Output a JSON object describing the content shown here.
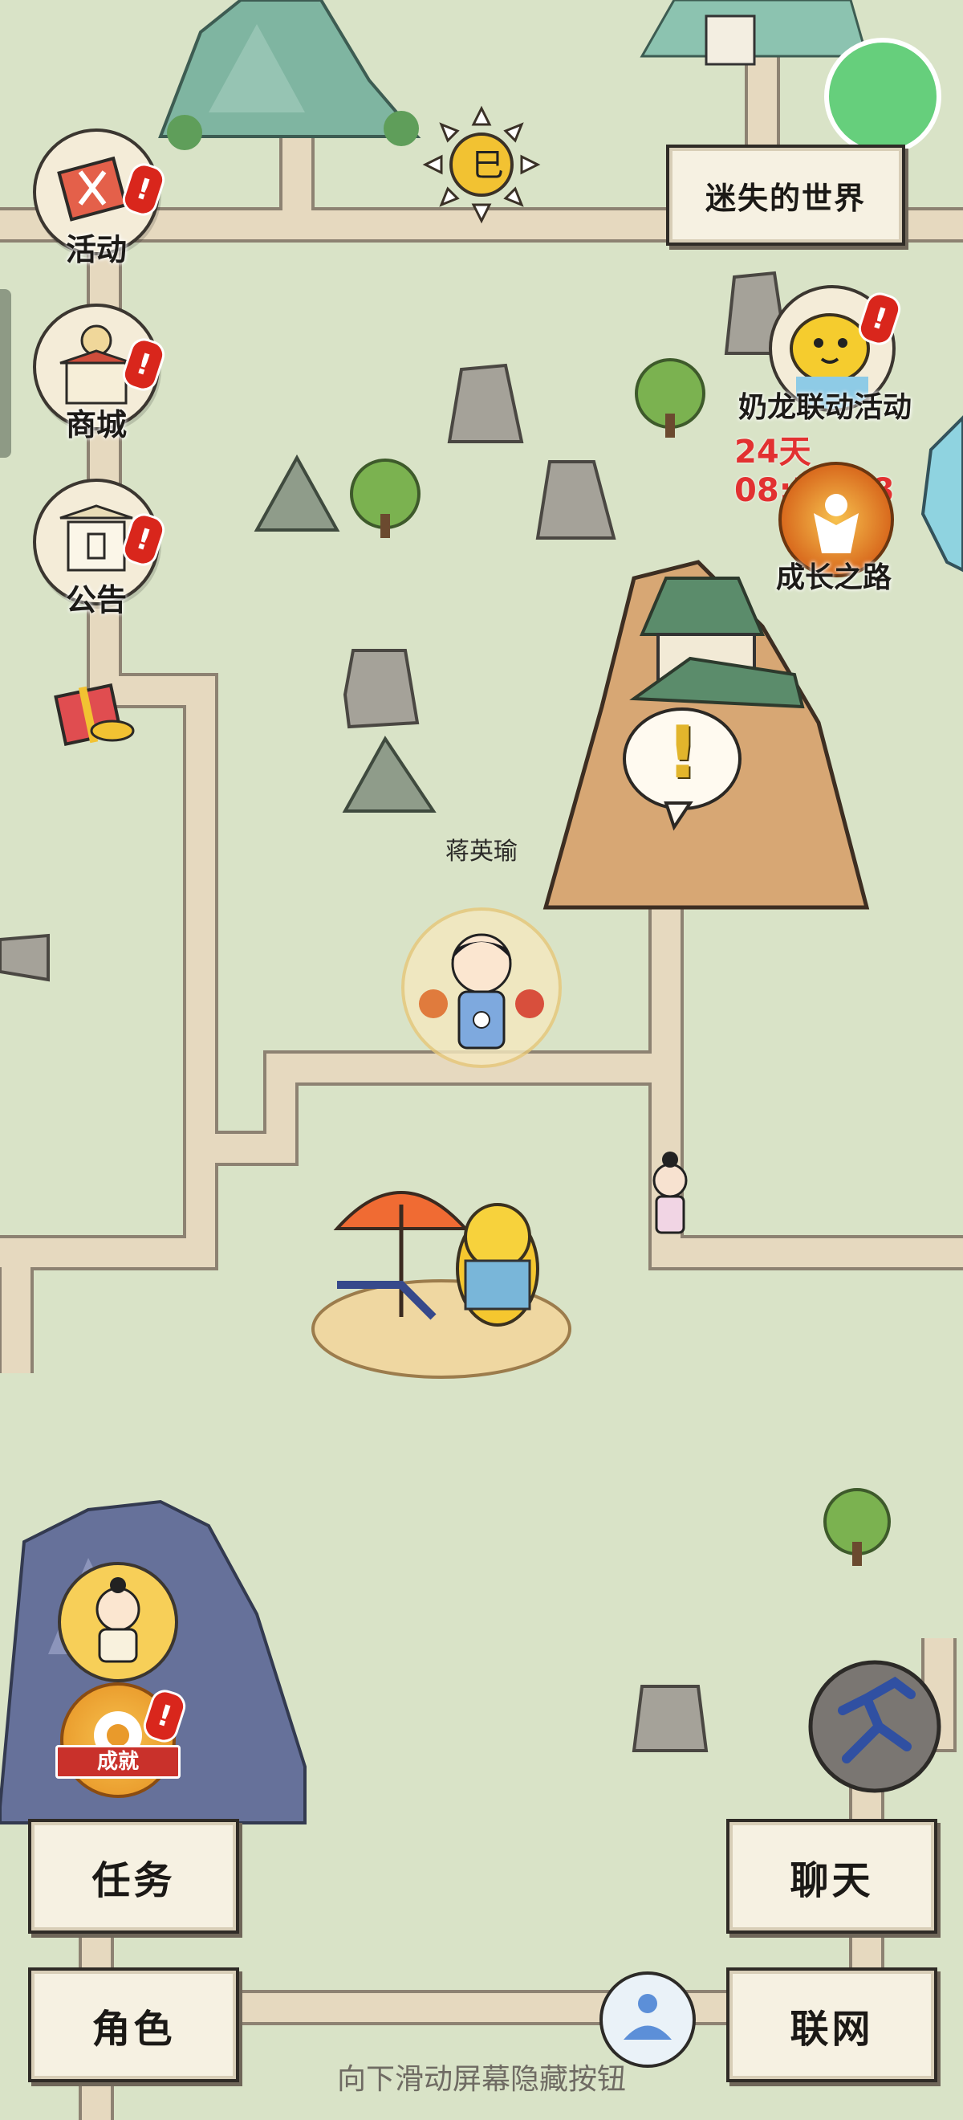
{
  "top_right": {
    "world_button": "迷失的世界"
  },
  "left_menu": [
    {
      "label": "活动",
      "icon": "banner-icon",
      "has_alert": true
    },
    {
      "label": "商城",
      "icon": "shop-icon",
      "has_alert": true
    },
    {
      "label": "公告",
      "icon": "notice-board-icon",
      "has_alert": true
    }
  ],
  "event": {
    "title": "奶龙联动活动",
    "countdown": "24天08:54:18",
    "growth_path": "成长之路"
  },
  "map": {
    "player_name": "蒋英瑜",
    "quest_marker": "!"
  },
  "achievement_badge": "成就",
  "bottom_buttons": {
    "tasks": "任务",
    "chat": "聊天",
    "character": "角色",
    "network": "联网"
  },
  "footer_hint": "向下滑动屏幕隐藏按钮",
  "colors": {
    "background": "#d9e3c7",
    "path": "#e6d9bf",
    "alert": "#d9261c",
    "timer": "#e23131"
  }
}
